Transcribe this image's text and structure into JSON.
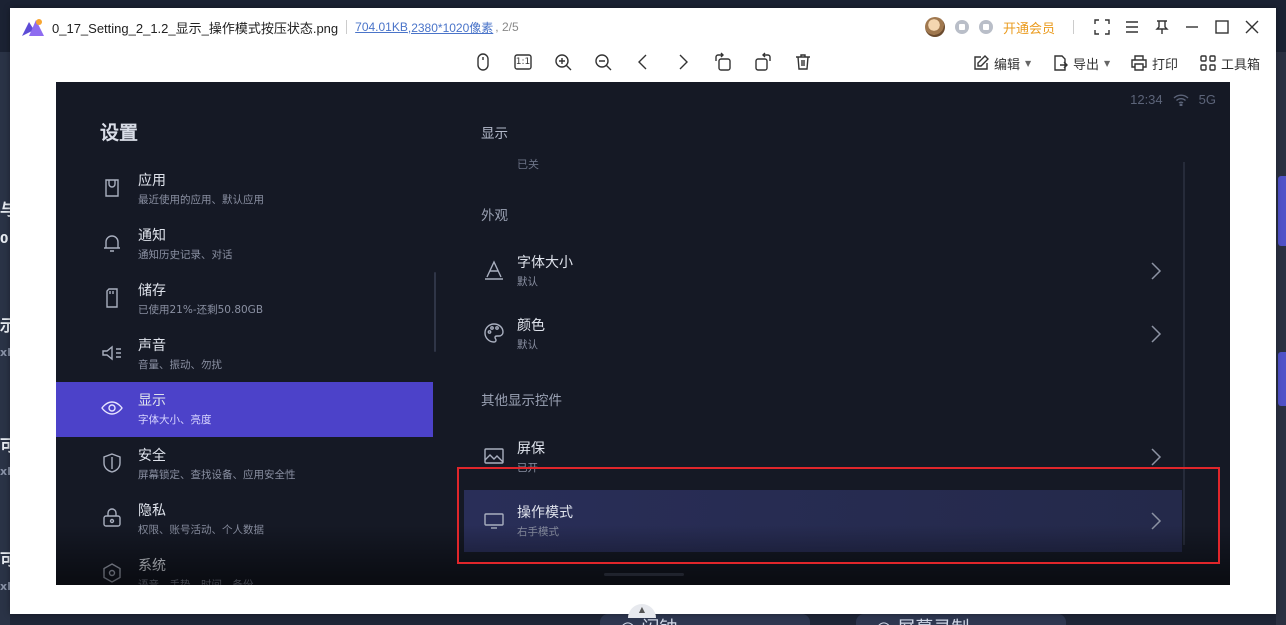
{
  "background": {
    "left_fragments": [
      "与",
      "0",
      "示",
      "xF",
      "可",
      "xF",
      "可",
      "xF"
    ],
    "bottom_pill_1": "◎ 闪钟",
    "bottom_pill_2": "◎ 屏幕录制"
  },
  "viewer": {
    "file_name": "0_17_Setting_2_1.2_显示_操作模式按压状态.png",
    "file_size": "704.01KB",
    "dimensions": ",2380*1020像素",
    "page_index": ", 2/5",
    "vip_label": "开通会员",
    "toolbar": {
      "edit_label": "编辑",
      "export_label": "导出",
      "print_label": "打印",
      "toolbox_label": "工具箱",
      "actual_size_label": "1:1"
    },
    "accent": "#ea9b1e"
  },
  "screen": {
    "status": {
      "time": "12:34",
      "network": "5G"
    },
    "settings_title": "设置",
    "left_items": [
      {
        "title": "应用",
        "sub": "最近使用的应用、默认应用",
        "icon": "apps-icon"
      },
      {
        "title": "通知",
        "sub": "通知历史记录、对话",
        "icon": "bell-icon"
      },
      {
        "title": "储存",
        "sub": "已使用21%-还剩50.80GB",
        "icon": "storage-icon"
      },
      {
        "title": "声音",
        "sub": "音量、振动、勿扰",
        "icon": "sound-icon"
      },
      {
        "title": "显示",
        "sub": "字体大小、亮度",
        "icon": "eye-icon"
      },
      {
        "title": "安全",
        "sub": "屏幕锁定、查找设备、应用安全性",
        "icon": "shield-icon"
      },
      {
        "title": "隐私",
        "sub": "权限、账号活动、个人数据",
        "icon": "lock-icon"
      },
      {
        "title": "系统",
        "sub": "语音、手势、时间、备份",
        "icon": "system-icon"
      }
    ],
    "right": {
      "header": "显示",
      "cut_sub": "已关",
      "section_appearance": "外观",
      "font_size": {
        "title": "字体大小",
        "sub": "默认"
      },
      "color": {
        "title": "颜色",
        "sub": "默认"
      },
      "section_other": "其他显示控件",
      "screensaver": {
        "title": "屏保",
        "sub": "已开"
      },
      "operation_mode": {
        "title": "操作模式",
        "sub": "右手模式"
      }
    },
    "accent": "#4c42c9",
    "highlight_color": "#e0262b"
  }
}
